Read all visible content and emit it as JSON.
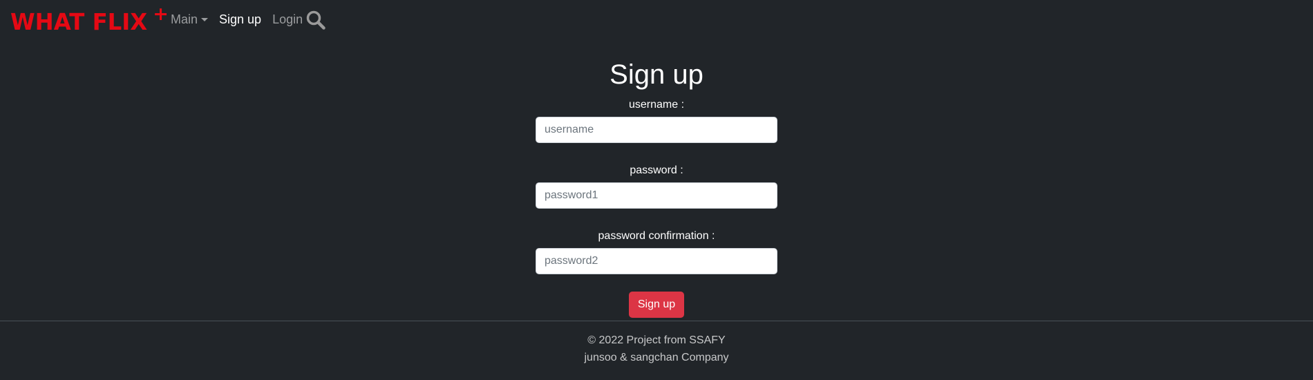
{
  "navbar": {
    "brand": "WHAT FLIX",
    "brand_suffix": "+",
    "links": [
      {
        "label": "Main"
      },
      {
        "label": "Sign up"
      },
      {
        "label": "Login"
      }
    ],
    "search_icon": "search-icon"
  },
  "signup": {
    "title": "Sign up",
    "fields": [
      {
        "label": "username :",
        "placeholder": "username",
        "value": ""
      },
      {
        "label": "password :",
        "placeholder": "password1",
        "value": ""
      },
      {
        "label": "password confirmation :",
        "placeholder": "password2",
        "value": ""
      }
    ],
    "submit_label": "Sign up"
  },
  "footer": {
    "line1": "© 2022 Project from SSAFY",
    "line2": "junsoo & sangchan Company"
  },
  "colors": {
    "background": "#212529",
    "brand": "#e50914",
    "button": "#dc3545"
  }
}
